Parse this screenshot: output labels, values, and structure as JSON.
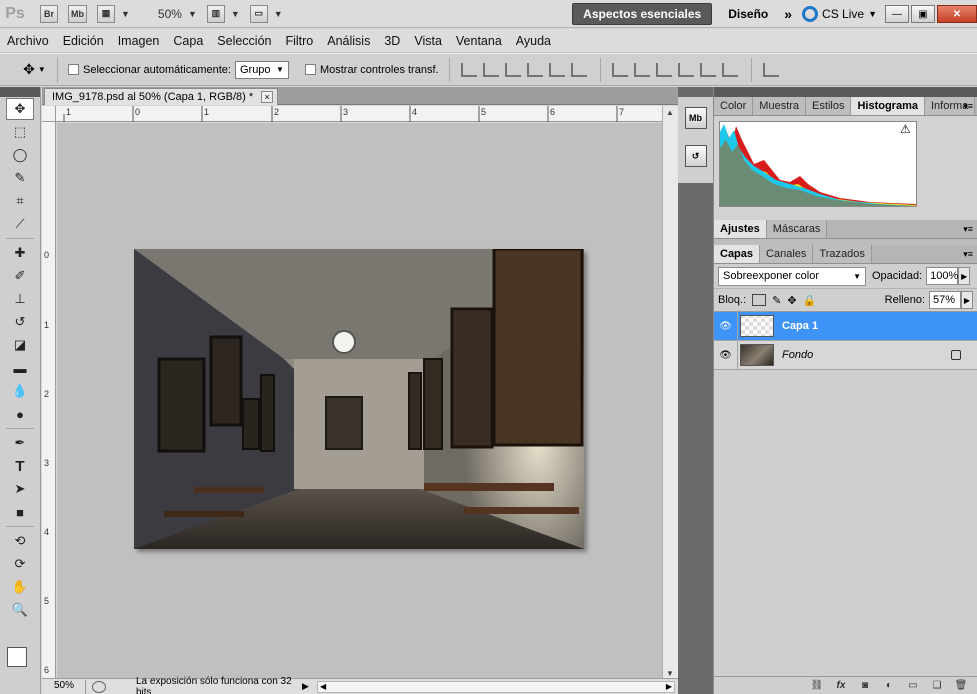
{
  "app": {
    "logo": "Ps",
    "bridge_label": "Br",
    "minibridge_label": "Mb",
    "zoom": "50%",
    "workspace_active": "Aspectos esenciales",
    "workspace_other": "Diseño",
    "more": "»",
    "cs_live": "CS Live"
  },
  "menu": [
    "Archivo",
    "Edición",
    "Imagen",
    "Capa",
    "Selección",
    "Filtro",
    "Análisis",
    "3D",
    "Vista",
    "Ventana",
    "Ayuda"
  ],
  "options": {
    "auto_select_label": "Seleccionar automáticamente:",
    "auto_select_value": "Grupo",
    "show_transform_label": "Mostrar controles transf."
  },
  "document": {
    "tab_title": "IMG_9178.psd al 50% (Capa 1, RGB/8) *",
    "tab_close": "×",
    "ruler_h": [
      "1",
      "0",
      "1",
      "2",
      "3",
      "4",
      "5",
      "6",
      "7",
      "8"
    ],
    "ruler_v": [
      "0",
      "1",
      "2",
      "3",
      "4",
      "5",
      "6"
    ]
  },
  "status": {
    "zoom": "50%",
    "message": "La exposición sólo funciona con 32 bits"
  },
  "panels": {
    "top_tabs": [
      "Color",
      "Muestra",
      "Estilos",
      "Histograma",
      "Informa"
    ],
    "top_active": "Histograma",
    "mid_tabs": [
      "Ajustes",
      "Máscaras"
    ],
    "layer_tabs": [
      "Capas",
      "Canales",
      "Trazados"
    ],
    "blend_mode": "Sobreexponer color",
    "opacity_label": "Opacidad:",
    "opacity_value": "100%",
    "lock_label": "Bloq.:",
    "fill_label": "Relleno:",
    "fill_value": "57%",
    "layers": [
      {
        "name": "Capa 1",
        "selected": true
      },
      {
        "name": "Fondo",
        "selected": false,
        "locked": true
      }
    ]
  },
  "colors": {
    "selection": "#3d94f6",
    "workspace_active_bg": "#5a5a5a",
    "close_button": "#c44125"
  }
}
